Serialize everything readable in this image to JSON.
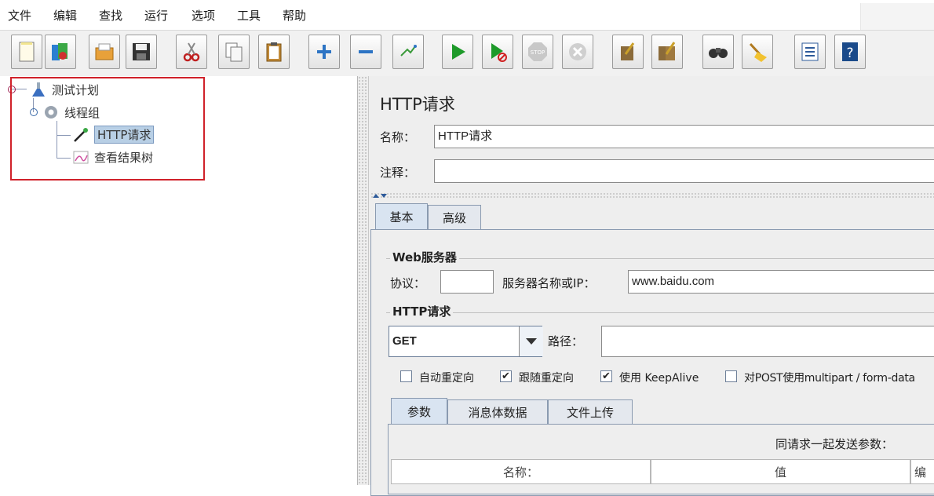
{
  "menu": [
    "文件",
    "编辑",
    "查找",
    "运行",
    "选项",
    "工具",
    "帮助"
  ],
  "toolbar": {
    "buttons": [
      "new-icon",
      "templates-icon",
      "open-icon",
      "save-icon",
      "cut-icon",
      "copy-icon",
      "paste-icon",
      "expand-icon",
      "collapse-icon",
      "toggle-icon",
      "start-icon",
      "start-no-timers-icon",
      "stop-icon",
      "shutdown-icon",
      "clear-icon",
      "clear-all-icon",
      "search-icon",
      "reset-search-icon",
      "function-helper-icon",
      "help-icon"
    ]
  },
  "tree": {
    "nodes": [
      {
        "label": "测试计划",
        "icon": "flask-icon"
      },
      {
        "label": "线程组",
        "icon": "gear-icon"
      },
      {
        "label": "HTTP请求",
        "icon": "pipette-icon"
      },
      {
        "label": "查看结果树",
        "icon": "graph-icon"
      }
    ]
  },
  "panel": {
    "title": "HTTP请求",
    "name_label": "名称：",
    "name_value": "HTTP请求",
    "comment_label": "注释：",
    "comment_value": "",
    "tabs": [
      "基本",
      "高级"
    ],
    "web_server": {
      "title": "Web服务器",
      "protocol_label": "协议：",
      "protocol_value": "",
      "server_label": "服务器名称或IP：",
      "server_value": "www.baidu.com"
    },
    "http_request": {
      "title": "HTTP请求",
      "method": "GET",
      "path_label": "路径：",
      "path_value": "",
      "checkboxes": [
        {
          "label": "自动重定向",
          "checked": false
        },
        {
          "label": "跟随重定向",
          "checked": true
        },
        {
          "label": "使用 KeepAlive",
          "checked": true
        },
        {
          "label": "对POST使用multipart / form-data",
          "checked": false
        }
      ]
    },
    "subtabs": [
      "参数",
      "消息体数据",
      "文件上传"
    ],
    "send_params_label": "同请求一起发送参数：",
    "table_headers": [
      "名称：",
      "值",
      "编"
    ]
  },
  "colors": {
    "highlight_box": "#d0212a",
    "selection": "#b8cfe5",
    "start_green": "#1e9a2a"
  }
}
